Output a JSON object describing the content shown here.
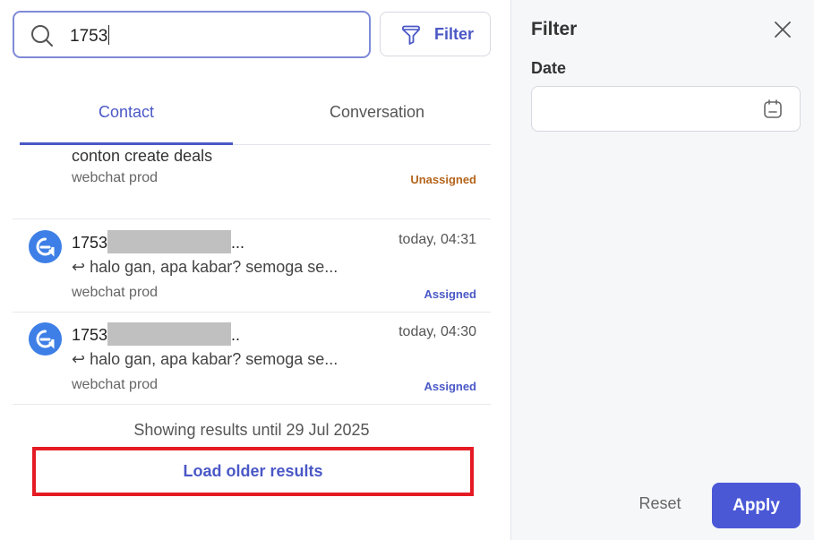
{
  "search": {
    "value": "1753"
  },
  "filter_button": {
    "label": "Filter"
  },
  "tabs": [
    {
      "label": "Contact",
      "active": true
    },
    {
      "label": "Conversation",
      "active": false
    }
  ],
  "results": [
    {
      "name": "conton create deals",
      "inbox": "webchat prod",
      "status": "Unassigned",
      "unread": true
    },
    {
      "name_prefix": "1753",
      "name_suffix": "...",
      "time": "today, 04:31",
      "message": "↩ halo gan, apa kabar? semoga se...",
      "inbox": "webchat prod",
      "status": "Assigned"
    },
    {
      "name_prefix": "1753",
      "name_suffix": "..",
      "time": "today, 04:30",
      "message": "↩ halo gan, apa kabar? semoga se...",
      "inbox": "webchat prod",
      "status": "Assigned"
    }
  ],
  "footer": {
    "showing_text": "Showing results until 29 Jul 2025",
    "load_more_label": "Load older results"
  },
  "filter_panel": {
    "title": "Filter",
    "date_label": "Date",
    "date_value": "",
    "reset_label": "Reset",
    "apply_label": "Apply"
  },
  "colors": {
    "accent": "#4a58c6",
    "apply_bg": "#4a58d6",
    "avatar": "#3d7fe6",
    "unassigned": "#b5651d",
    "highlight_box": "#e51b23"
  },
  "icons": {
    "search": "search-icon",
    "filter": "funnel-icon",
    "close": "close-icon",
    "calendar": "calendar-icon",
    "avatar": "webchat-logo-icon"
  }
}
